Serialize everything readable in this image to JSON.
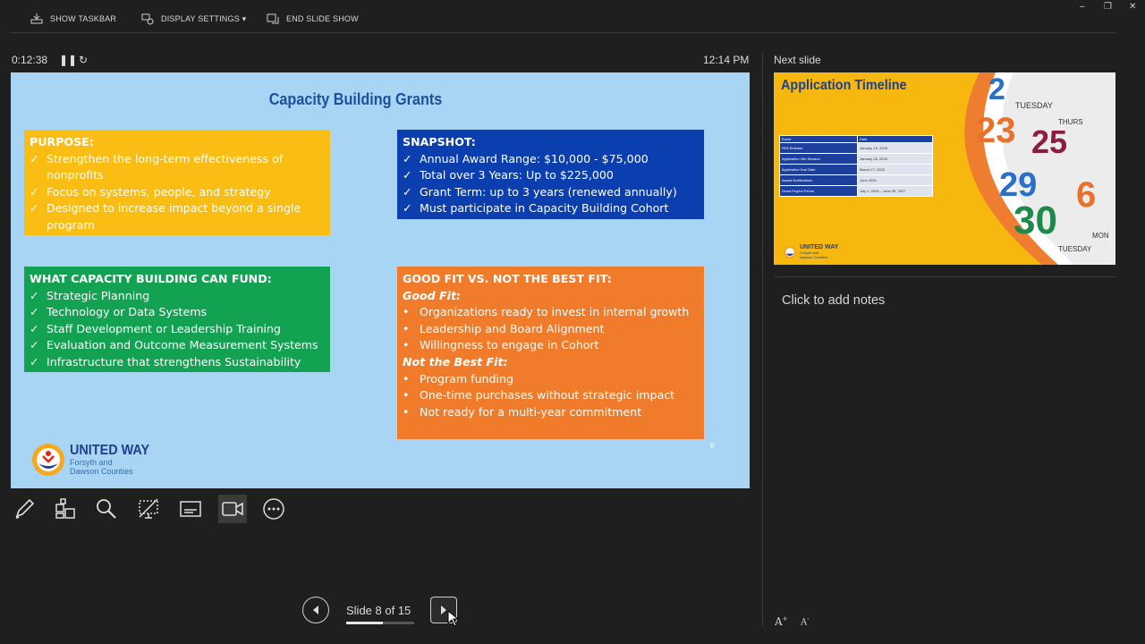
{
  "toolbar": {
    "show_taskbar": "SHOW TASKBAR",
    "display_settings": "DISPLAY SETTINGS ▾",
    "end_slide_show": "END SLIDE SHOW"
  },
  "window_controls": {
    "minimize": "‒",
    "restore": "❐",
    "close": "✕"
  },
  "status": {
    "elapsed": "0:12:38",
    "clock": "12:14 PM",
    "next_slide_label": "Next slide"
  },
  "slide": {
    "title": "Capacity Building Grants",
    "purpose": {
      "heading": "PURPOSE:",
      "items": [
        "Strengthen the long-term effectiveness of nonprofits",
        "Focus on systems, people, and strategy",
        "Designed to increase impact beyond a single program"
      ]
    },
    "snapshot": {
      "heading": "SNAPSHOT:",
      "items": [
        "Annual Award Range: $10,000 - $75,000",
        "Total over 3 Years: Up to $225,000",
        "Grant Term: up to 3 years (renewed annually)",
        "Must participate in Capacity Building Cohort"
      ]
    },
    "fund": {
      "heading": "WHAT CAPACITY BUILDING CAN FUND:",
      "items": [
        "Strategic Planning",
        "Technology or Data Systems",
        "Staff Development or Leadership Training",
        "Evaluation and Outcome Measurement Systems",
        "Infrastructure that strengthens Sustainability"
      ]
    },
    "fit": {
      "heading": "GOOD FIT VS. NOT THE BEST FIT:",
      "good_label": "Good Fit:",
      "good_items": [
        "Organizations ready to invest in internal growth",
        "Leadership and Board Alignment",
        "Willingness to engage in Cohort"
      ],
      "not_label": "Not the Best Fit:",
      "not_items": [
        "Program funding",
        "One-time purchases without strategic impact",
        "Not ready for a multi-year commitment"
      ]
    },
    "page_number": "8",
    "logo": {
      "name": "UNITED WAY",
      "line1": "Forsyth and",
      "line2": "Dawson Counties"
    }
  },
  "next_slide": {
    "title": "Application Timeline",
    "table_header": [
      "Event",
      "Date"
    ],
    "rows": [
      [
        "RFA Release",
        "January 15, 2026"
      ],
      [
        "Application Info Session",
        "January 28, 2026"
      ],
      [
        "Application Due Date",
        "March 27, 2026"
      ],
      [
        "Award Notifications",
        "June 2026"
      ],
      [
        "Grant Project Period",
        "July 1, 2026 – June 30, 2027"
      ]
    ],
    "logo": {
      "name": "UNITED WAY",
      "line1": "Forsyth and",
      "line2": "Dawson Counties"
    }
  },
  "notes_placeholder": "Click to add notes",
  "navigation": {
    "slide_counter": "Slide 8 of 15",
    "progress_fraction": 0.533
  },
  "fonts_buttons": {
    "increase": "A",
    "decrease": "A"
  }
}
